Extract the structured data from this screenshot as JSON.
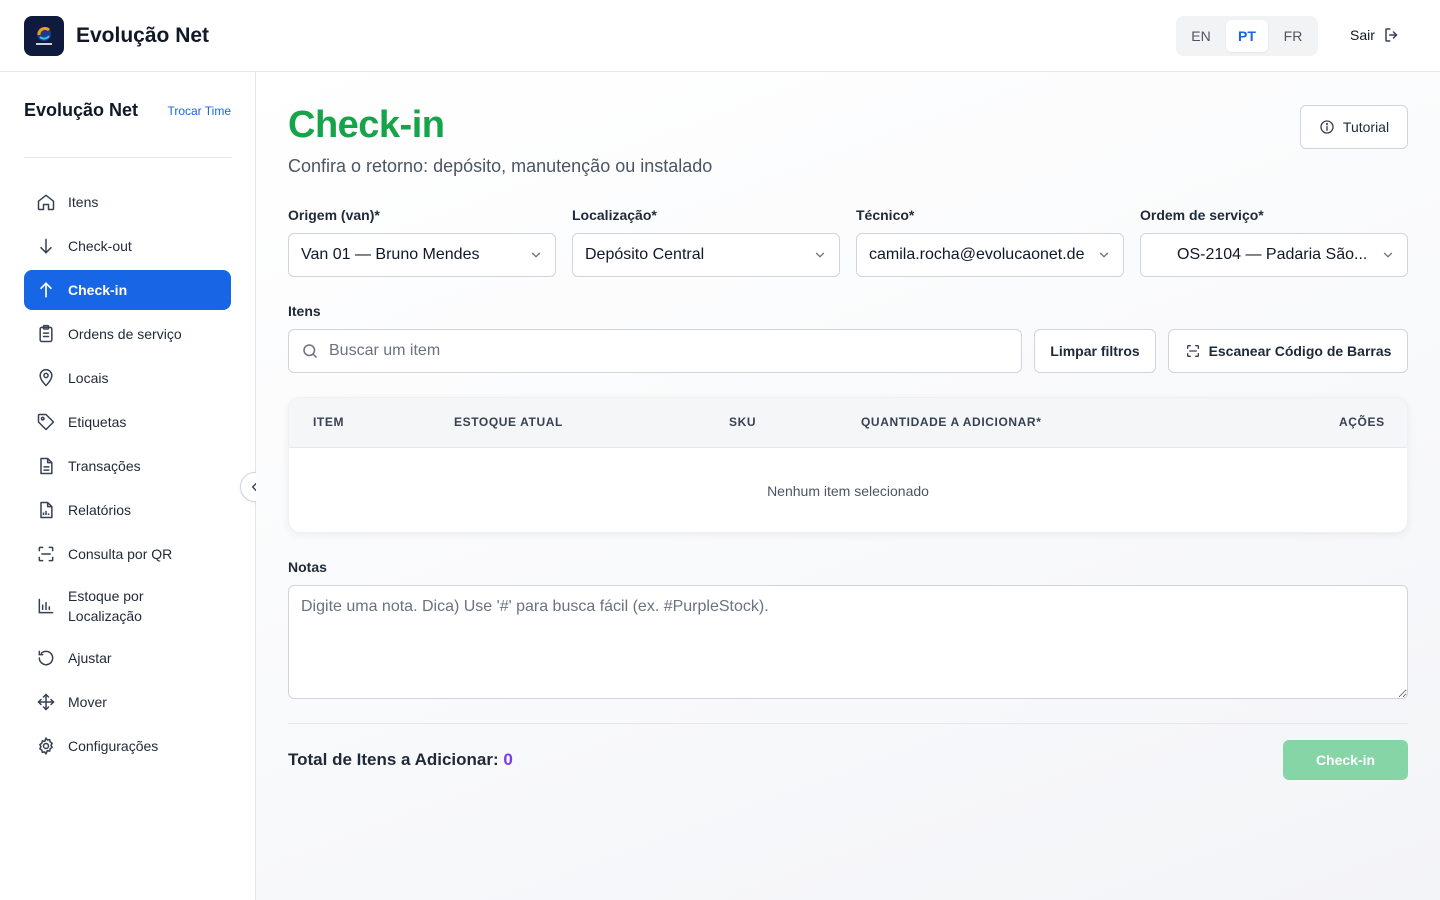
{
  "app": {
    "brand": "Evolução Net",
    "languages": [
      {
        "code": "EN",
        "active": false
      },
      {
        "code": "PT",
        "active": true
      },
      {
        "code": "FR",
        "active": false
      }
    ],
    "logout_label": "Sair"
  },
  "sidebar": {
    "team_name": "Evolução Net",
    "switch_team": "Trocar Time",
    "items": [
      {
        "label": "Itens",
        "icon": "home-icon"
      },
      {
        "label": "Check-out",
        "icon": "arrow-down-icon"
      },
      {
        "label": "Check-in",
        "icon": "arrow-up-icon",
        "active": true
      },
      {
        "label": "Ordens de serviço",
        "icon": "clipboard-icon"
      },
      {
        "label": "Locais",
        "icon": "map-pin-icon"
      },
      {
        "label": "Etiquetas",
        "icon": "tag-icon"
      },
      {
        "label": "Transações",
        "icon": "document-icon"
      },
      {
        "label": "Relatórios",
        "icon": "report-icon"
      },
      {
        "label": "Consulta por QR",
        "icon": "scan-icon"
      },
      {
        "label": "Estoque por Localização",
        "icon": "bar-chart-icon"
      },
      {
        "label": "Ajustar",
        "icon": "rotate-icon"
      },
      {
        "label": "Mover",
        "icon": "move-icon"
      },
      {
        "label": "Configurações",
        "icon": "gear-icon"
      }
    ]
  },
  "page": {
    "title": "Check-in",
    "subtitle": "Confira o retorno: depósito, manutenção ou instalado",
    "tutorial_label": "Tutorial"
  },
  "form": {
    "origin": {
      "label": "Origem (van)*",
      "value": "Van 01 — Bruno Mendes"
    },
    "location": {
      "label": "Localização*",
      "value": "Depósito Central"
    },
    "technician": {
      "label": "Técnico*",
      "value": "camila.rocha@evolucaonet.de"
    },
    "service_order": {
      "label": "Ordem de serviço*",
      "value": "OS-2104 — Padaria São..."
    }
  },
  "items": {
    "label": "Itens",
    "search_placeholder": "Buscar um item",
    "clear_filters": "Limpar filtros",
    "scan_barcode": "Escanear Código de Barras",
    "columns": [
      "ITEM",
      "ESTOQUE ATUAL",
      "SKU",
      "QUANTIDADE A ADICIONAR*",
      "AÇÕES"
    ],
    "empty_text": "Nenhum item selecionado"
  },
  "notes": {
    "label": "Notas",
    "placeholder": "Digite uma nota. Dica) Use '#' para busca fácil (ex. #PurpleStock)."
  },
  "footer": {
    "total_label": "Total de Itens a Adicionar:",
    "total_count": "0",
    "submit_label": "Check-in"
  },
  "colors": {
    "primary": "#1666e6",
    "title_green": "#16a34a",
    "submit_disabled": "#86d5a6",
    "count_purple": "#7c3aed"
  }
}
